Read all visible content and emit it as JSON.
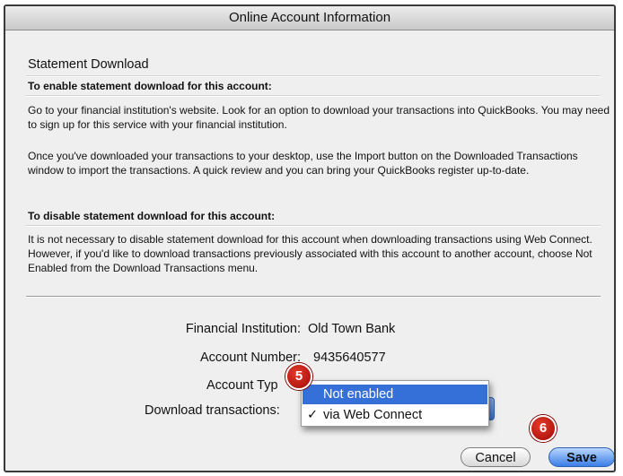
{
  "window": {
    "title": "Online Account Information"
  },
  "section": {
    "title": "Statement Download"
  },
  "enable": {
    "heading": "To enable statement download for this account:",
    "para1": "Go to your financial institution's website. Look for an option to download your transactions into QuickBooks. You may need to sign up for this service with your financial institution.",
    "para2": "Once you've downloaded your transactions to your desktop, use the Import button on the Downloaded Transactions window to import the transactions. A quick review and you can bring your QuickBooks register up-to-date."
  },
  "disable": {
    "heading": "To disable statement download for this account:",
    "para": "It is not necessary to disable statement download for this account when downloading transactions using Web Connect. However, if you'd like to download transactions previously associated with this account to another account, choose Not Enabled from the Download Transactions menu."
  },
  "fields": {
    "institution_label": "Financial Institution:",
    "institution_value": "Old Town Bank",
    "account_number_label": "Account Number:",
    "account_number_value": "9435640577",
    "account_type_label": "Account Typ",
    "download_label": "Download transactions:"
  },
  "download_menu": {
    "options": [
      {
        "label": "Not enabled",
        "highlighted": true,
        "checked": false
      },
      {
        "label": "via Web Connect",
        "highlighted": false,
        "checked": true
      }
    ],
    "check_mark": "✓"
  },
  "badges": {
    "step5": "5",
    "step6": "6"
  },
  "buttons": {
    "cancel": "Cancel",
    "save": "Save"
  },
  "colors": {
    "accent": "#3470d8",
    "badge": "#c8140c"
  }
}
